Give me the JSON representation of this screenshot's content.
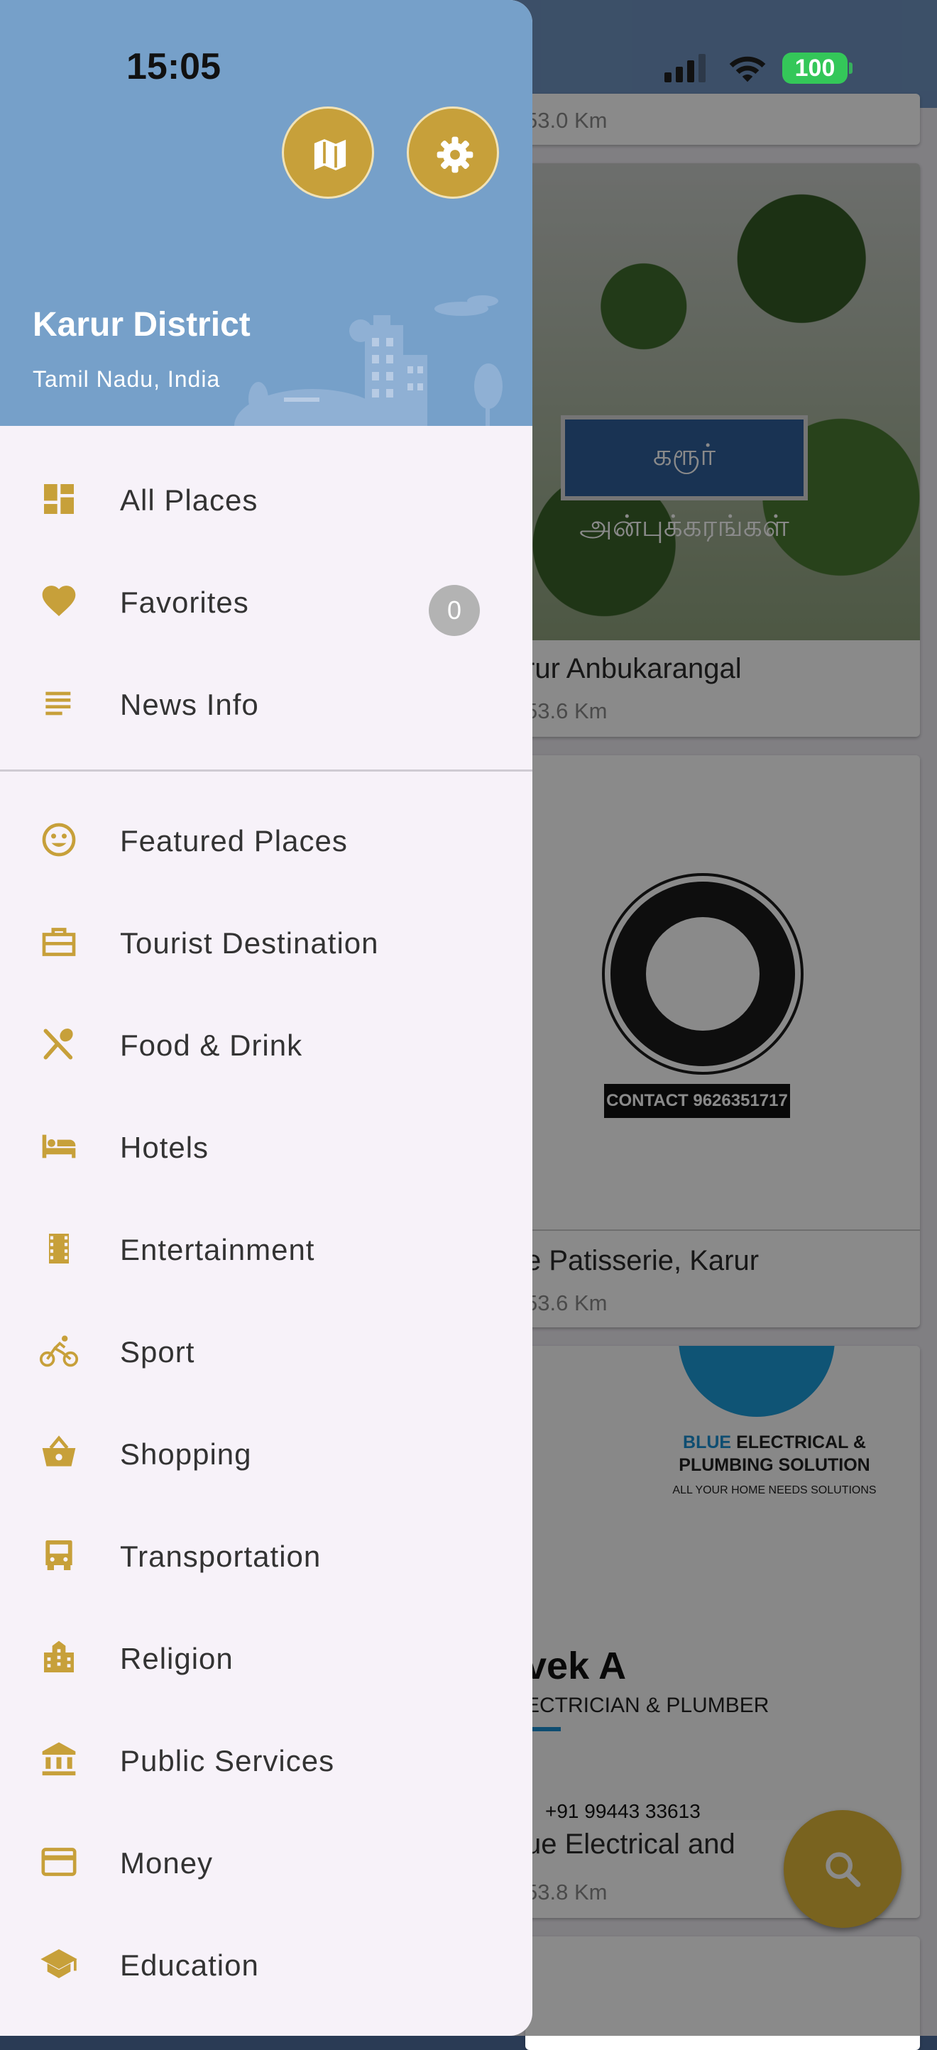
{
  "status_bar": {
    "time": "15:05",
    "battery": "100"
  },
  "drawer": {
    "district": "Karur District",
    "location": "Tamil Nadu, India",
    "favorites_count": "0",
    "primary_items": [
      {
        "label": "All Places",
        "icon": "dashboard-icon"
      },
      {
        "label": "Favorites",
        "icon": "heart-icon"
      },
      {
        "label": "News Info",
        "icon": "notes-icon"
      }
    ],
    "category_items": [
      {
        "label": "Featured Places",
        "icon": "smiley-icon"
      },
      {
        "label": "Tourist Destination",
        "icon": "suitcase-icon"
      },
      {
        "label": "Food & Drink",
        "icon": "utensils-icon"
      },
      {
        "label": "Hotels",
        "icon": "bed-icon"
      },
      {
        "label": "Entertainment",
        "icon": "film-icon"
      },
      {
        "label": "Sport",
        "icon": "bike-icon"
      },
      {
        "label": "Shopping",
        "icon": "basket-icon"
      },
      {
        "label": "Transportation",
        "icon": "bus-icon"
      },
      {
        "label": "Religion",
        "icon": "building-icon"
      },
      {
        "label": "Public Services",
        "icon": "bank-icon"
      },
      {
        "label": "Money",
        "icon": "credit-card-icon"
      },
      {
        "label": "Education",
        "icon": "school-icon"
      }
    ]
  },
  "background_list": [
    {
      "title": "",
      "distance": "53.0 Km"
    },
    {
      "title": "rur Anbukarangal",
      "distance": "53.6 Km",
      "sign_text": "கரூர் அன்புக்கரங்கள்"
    },
    {
      "title": "e Patisserie, Karur",
      "distance": "53.6 Km",
      "contact": "CONTACT 9626351717"
    },
    {
      "title": "ue Electrical and",
      "distance": "53.8 Km",
      "brand_blue": "BLUE",
      "brand_rest": "ELECTRICAL &",
      "brand_line2": "PLUMBING SOLUTION",
      "brand_tag": "ALL YOUR HOME NEEDS SOLUTIONS",
      "person": "vek A",
      "role": "ECTRICIAN & PLUMBER",
      "phone": "+91 99443 33613"
    }
  ],
  "colors": {
    "accent": "#c7a03a",
    "header": "#76a0c9",
    "drawer_bg": "#f7f2f9"
  }
}
